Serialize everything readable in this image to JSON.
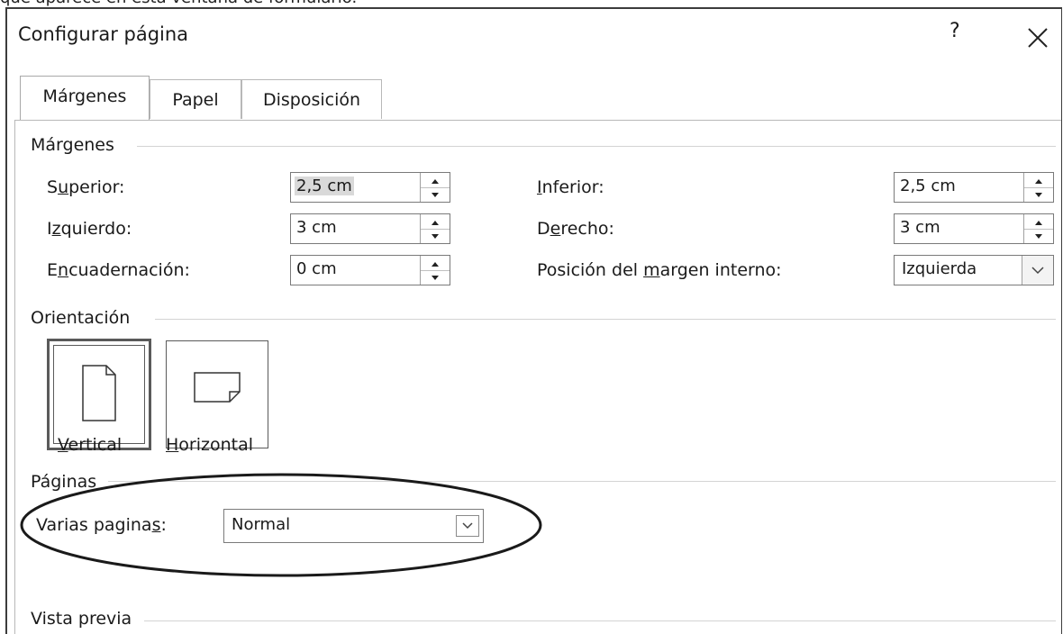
{
  "top_fragment": "que aparece en esta ventana de formulario.",
  "dialog": {
    "title": "Configurar página",
    "help_label": "?"
  },
  "tabs": [
    {
      "label": "Márgenes",
      "active": true
    },
    {
      "label": "Papel",
      "active": false
    },
    {
      "label": "Disposición",
      "active": false
    }
  ],
  "margins": {
    "group_label": "Márgenes",
    "superior": {
      "label_pre": "S",
      "label_ul": "u",
      "label_post": "perior:",
      "value": "2,5 cm"
    },
    "inferior": {
      "label_pre": "",
      "label_ul": "I",
      "label_post": "nferior:",
      "value": "2,5 cm"
    },
    "izquierdo": {
      "label_pre": "I",
      "label_ul": "z",
      "label_post": "quierdo:",
      "value": "3 cm"
    },
    "derecho": {
      "label_pre": "D",
      "label_ul": "e",
      "label_post": "recho:",
      "value": "3 cm"
    },
    "encuadernacion": {
      "label_pre": "E",
      "label_ul": "n",
      "label_post": "cuadernación:",
      "value": "0 cm"
    },
    "posicion": {
      "label_pre": "Posición del ",
      "label_ul": "m",
      "label_post": "argen interno:",
      "value": "Izquierda"
    }
  },
  "orientation": {
    "group_label": "Orientación",
    "vertical": {
      "label_ul": "V",
      "label_post": "ertical",
      "selected": true
    },
    "horizontal": {
      "label_ul": "H",
      "label_post": "orizontal",
      "selected": false
    }
  },
  "pages": {
    "group_label": "Páginas",
    "varias": {
      "label_pre": "Varias pagina",
      "label_ul": "s",
      "label_post": ":",
      "value": "Normal"
    }
  },
  "preview": {
    "group_label": "Vista previa"
  },
  "colors": {
    "border": "#7a7a7a",
    "selection": "#d9d9d9",
    "annotation": "#1a1a1a"
  }
}
